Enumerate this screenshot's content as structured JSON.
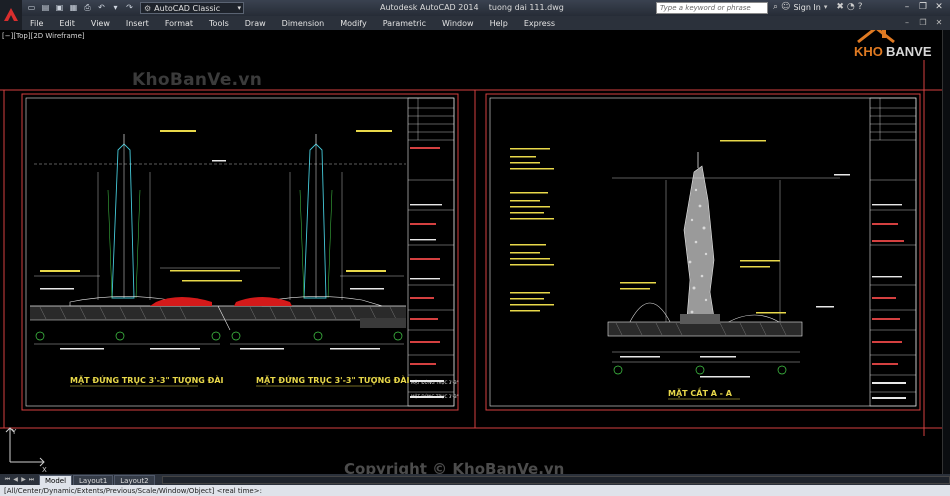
{
  "window": {
    "app_title": "Autodesk AutoCAD 2014",
    "file_name": "tuong dai 111.dwg",
    "workspace": "AutoCAD Classic",
    "search_placeholder": "Type a keyword or phrase",
    "sign_in": "Sign In",
    "minimize": "–",
    "restore": "❐",
    "close": "✕"
  },
  "menu": [
    "File",
    "Edit",
    "View",
    "Insert",
    "Format",
    "Tools",
    "Draw",
    "Dimension",
    "Modify",
    "Parametric",
    "Window",
    "Help",
    "Express"
  ],
  "viewport": {
    "label": "[−][Top][2D Wireframe]"
  },
  "watermarks": {
    "site": "KhoBanVe.vn",
    "copyright": "Copyright © KhoBanVe.vn",
    "brand": "KHOBANVE"
  },
  "drawing": {
    "sheet1_title_left": "MẶT ĐỨNG TRỤC 3'-3\" TƯỢNG ĐÀI",
    "sheet1_title_right": "MẶT ĐỨNG TRỤC 3'-3\" TƯỢNG ĐÀI",
    "sheet2_title": "MẶT CẮT A - A",
    "sheet1_block": "MẶT ĐỨNG TRỤC 3'-3\"",
    "sheet1_block2": "MẶT ĐỨNG TRỤC 3'-3\""
  },
  "tabs": [
    "Model",
    "Layout1",
    "Layout2"
  ],
  "command_line": "[All/Center/Dynamic/Extents/Previous/Scale/Window/Object] <real time>:",
  "colors": {
    "sheet_border": "#d44040",
    "line_white": "#e8e8e8",
    "line_yellow": "#e8d84a",
    "line_cyan": "#45c8d8",
    "line_green": "#46d24a",
    "accent_red": "#d41a1a",
    "brand_orange": "#e07a22"
  }
}
